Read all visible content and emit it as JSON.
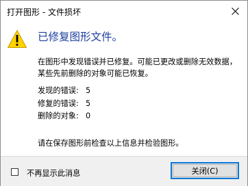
{
  "window": {
    "title": "打开图形 - 文件损坏"
  },
  "message": {
    "heading": "已修复图形文件。",
    "description": "在图形中发现错误并已修复。可能已更改或删除无效数据，某些先前删除的对象可能已恢复。",
    "stats": [
      {
        "label": "发现的错误:",
        "value": "5"
      },
      {
        "label": "修复的错误:",
        "value": "5"
      },
      {
        "label": "删除的对象:",
        "value": "0"
      }
    ],
    "note": "请在保存图形前检查以上信息并检验图形。"
  },
  "footer": {
    "checkbox_label": "不再显示此消息",
    "checkbox_checked": false,
    "close_button_label": "关闭(C)"
  },
  "colors": {
    "heading": "#1e3f9e",
    "warning_yellow": "#ffd200",
    "button_focus_border": "#0a78d7"
  },
  "icons": {
    "warning": "warning-triangle-icon",
    "close": "close-icon"
  }
}
